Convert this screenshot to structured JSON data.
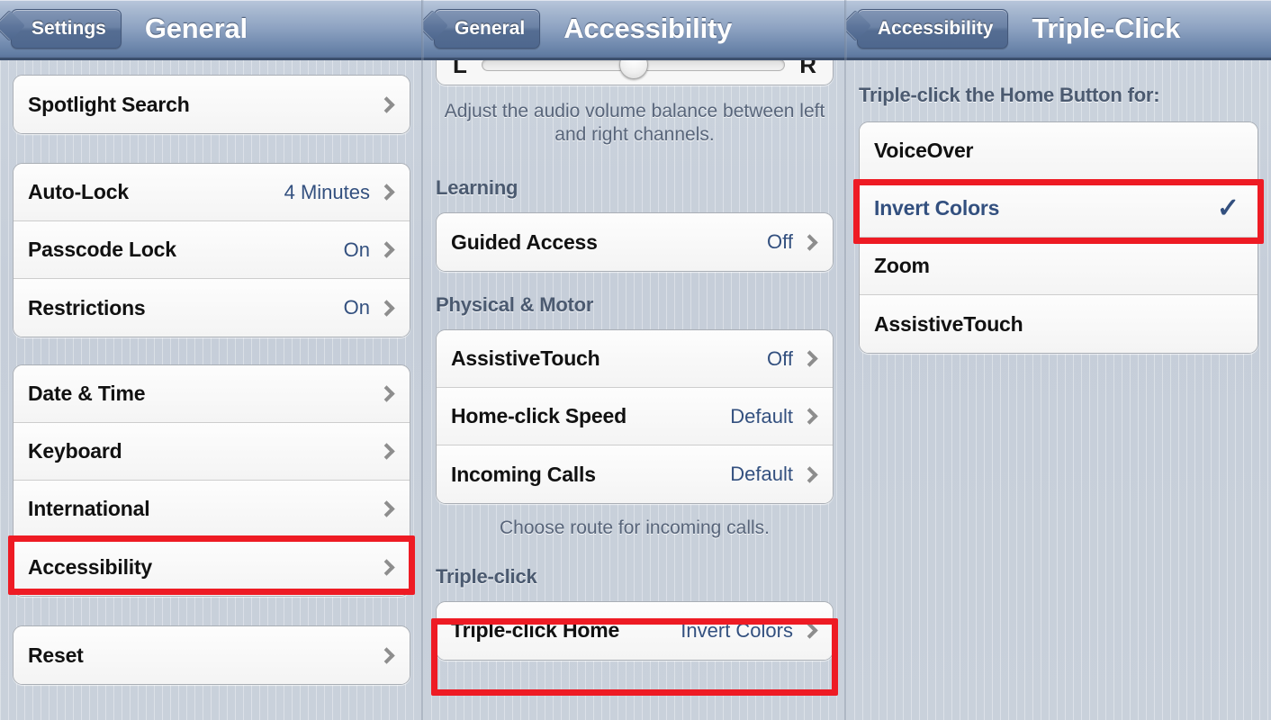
{
  "panels": {
    "general": {
      "nav": {
        "back_label": "Settings",
        "title": "General"
      },
      "group1": [
        {
          "label": "Spotlight Search",
          "value": "",
          "accessory": "chevron"
        }
      ],
      "group2": [
        {
          "label": "Auto-Lock",
          "value": "4 Minutes",
          "accessory": "chevron"
        },
        {
          "label": "Passcode Lock",
          "value": "On",
          "accessory": "chevron"
        },
        {
          "label": "Restrictions",
          "value": "On",
          "accessory": "chevron"
        }
      ],
      "group3": [
        {
          "label": "Date & Time",
          "value": "",
          "accessory": "chevron"
        },
        {
          "label": "Keyboard",
          "value": "",
          "accessory": "chevron"
        },
        {
          "label": "International",
          "value": "",
          "accessory": "chevron"
        },
        {
          "label": "Accessibility",
          "value": "",
          "accessory": "chevron",
          "highlighted": true
        }
      ],
      "group4": [
        {
          "label": "Reset",
          "value": "",
          "accessory": "chevron"
        }
      ]
    },
    "accessibility": {
      "nav": {
        "back_label": "General",
        "title": "Accessibility"
      },
      "slider": {
        "left_cap": "L",
        "right_cap": "R",
        "position_percent": 50
      },
      "balance_footnote": "Adjust the audio volume balance between left and right channels.",
      "learning_header": "Learning",
      "learning_rows": [
        {
          "label": "Guided Access",
          "value": "Off",
          "accessory": "chevron"
        }
      ],
      "physical_header": "Physical & Motor",
      "physical_rows": [
        {
          "label": "AssistiveTouch",
          "value": "Off",
          "accessory": "chevron"
        },
        {
          "label": "Home-click Speed",
          "value": "Default",
          "accessory": "chevron"
        },
        {
          "label": "Incoming Calls",
          "value": "Default",
          "accessory": "chevron"
        }
      ],
      "calls_footnote": "Choose route for incoming calls.",
      "tripleclick_header": "Triple-click",
      "tripleclick_rows": [
        {
          "label": "Triple-click Home",
          "value": "Invert Colors",
          "accessory": "chevron",
          "highlighted": true
        }
      ]
    },
    "tripleclick": {
      "nav": {
        "back_label": "Accessibility",
        "title": "Triple-Click"
      },
      "list_header": "Triple-click the Home Button for:",
      "options": [
        {
          "label": "VoiceOver",
          "selected": false
        },
        {
          "label": "Invert Colors",
          "selected": true,
          "highlighted": true
        },
        {
          "label": "Zoom",
          "selected": false
        },
        {
          "label": "AssistiveTouch",
          "selected": false
        }
      ]
    }
  },
  "colors": {
    "accent_blue": "#33507f",
    "annotation_red": "#ee1b24",
    "navbar_blue": "#5a7299",
    "section_header_gray": "#4b5a70"
  },
  "icons": {
    "chevron": "chevron-right-icon",
    "checkmark": "checkmark-icon"
  }
}
